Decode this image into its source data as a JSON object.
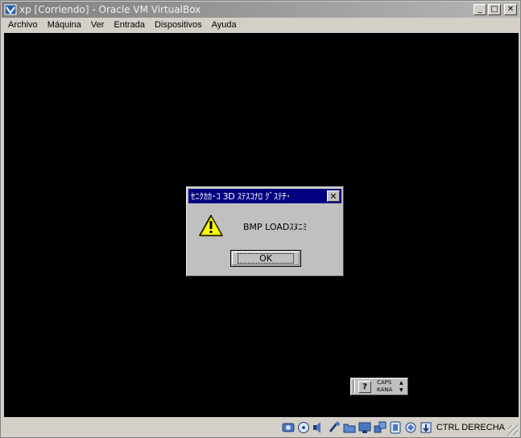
{
  "window": {
    "title": "xp [Corriendo] - Oracle VM VirtualBox",
    "buttons": {
      "minimize": "_",
      "maximize": "□",
      "close": "✕"
    }
  },
  "menu": {
    "items": [
      "Archivo",
      "Máquina",
      "Ver",
      "Entrada",
      "Dispositivos",
      "Ayuda"
    ]
  },
  "dialog": {
    "title": "ｾﾆｸｶｶ･ｺ 3D ｽﾃｽｺﾅﾛ ｸﾞｽﾃﾁ･",
    "message": "BMP LOADｽﾇﾆﾐ",
    "ok_label": "OK",
    "close_glyph": "✕",
    "icon": "warning-icon"
  },
  "ime": {
    "help_glyph": "?",
    "caps": "CAPS",
    "kana": "KANA"
  },
  "status": {
    "icons": [
      "hard-disk-icon",
      "optical-drive-icon",
      "audio-icon",
      "usb-icon",
      "shared-folders-icon",
      "display-icon",
      "network-icon",
      "video-capture-icon",
      "cpu-icon",
      "mouse-integration-icon"
    ],
    "host_key": "CTRL DERECHA"
  },
  "colors": {
    "titlebar_inactive": "#808080",
    "dialog_title": "#000080",
    "screen": "#000000",
    "chrome": "#d4d0c8"
  }
}
